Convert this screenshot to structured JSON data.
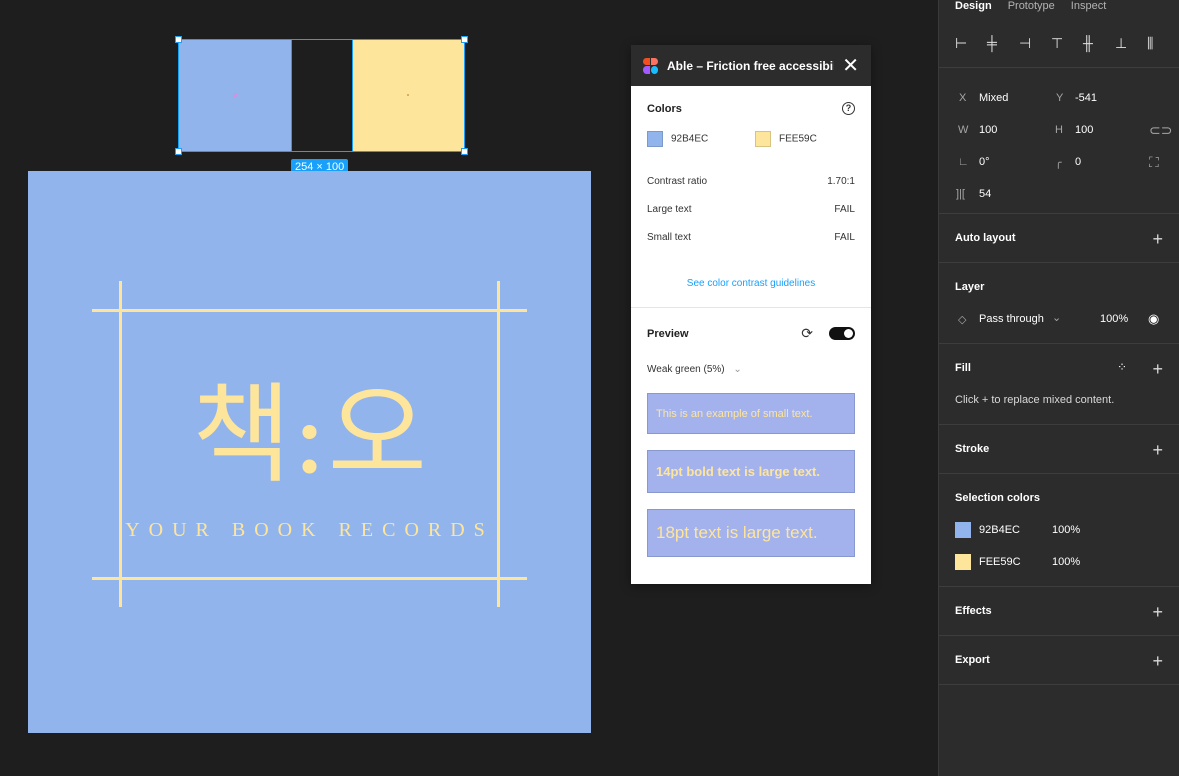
{
  "canvas": {
    "size_badge": "254 × 100",
    "artboard": {
      "logo_main": "책:오",
      "logo_sub": "YOUR BOOK RECORDS"
    },
    "colors": {
      "blue": "#92B4EC",
      "yellow": "#FEE59C",
      "selection": "#18a0fb"
    }
  },
  "plugin": {
    "title": "Able – Friction free accessibili...",
    "colors_label": "Colors",
    "help_icon": "?",
    "color1": {
      "hex": "92B4EC",
      "value": "#92B4EC"
    },
    "color2": {
      "hex": "FEE59C",
      "value": "#FEE59C"
    },
    "contrast_ratio_label": "Contrast ratio",
    "contrast_ratio_value": "1.70:1",
    "large_text_label": "Large text",
    "large_text_value": "FAIL",
    "small_text_label": "Small text",
    "small_text_value": "FAIL",
    "guidelines_link": "See color contrast guidelines",
    "preview_label": "Preview",
    "preview_toggle_on": true,
    "vision_select": "Weak green (5%)",
    "samples": [
      "This is an example of small text.",
      "14pt bold text is large text.",
      "18pt text is large text."
    ]
  },
  "panel": {
    "tabs": [
      "Design",
      "Prototype",
      "Inspect"
    ],
    "active_tab": "Design",
    "x_label": "X",
    "x_value": "Mixed",
    "y_label": "Y",
    "y_value": "-541",
    "w_label": "W",
    "w_value": "100",
    "h_label": "H",
    "h_value": "100",
    "rotation_value": "0°",
    "radius_value": "0",
    "spacing_value": "54",
    "auto_layout": "Auto layout",
    "layer": "Layer",
    "blend_mode": "Pass through",
    "layer_opacity": "100%",
    "fill": "Fill",
    "fill_hint": "Click + to replace mixed content.",
    "stroke": "Stroke",
    "selection_colors": "Selection colors",
    "sel_colors": [
      {
        "hex": "92B4EC",
        "opacity": "100%",
        "value": "#92B4EC"
      },
      {
        "hex": "FEE59C",
        "opacity": "100%",
        "value": "#FEE59C"
      }
    ],
    "effects": "Effects",
    "export": "Export"
  }
}
